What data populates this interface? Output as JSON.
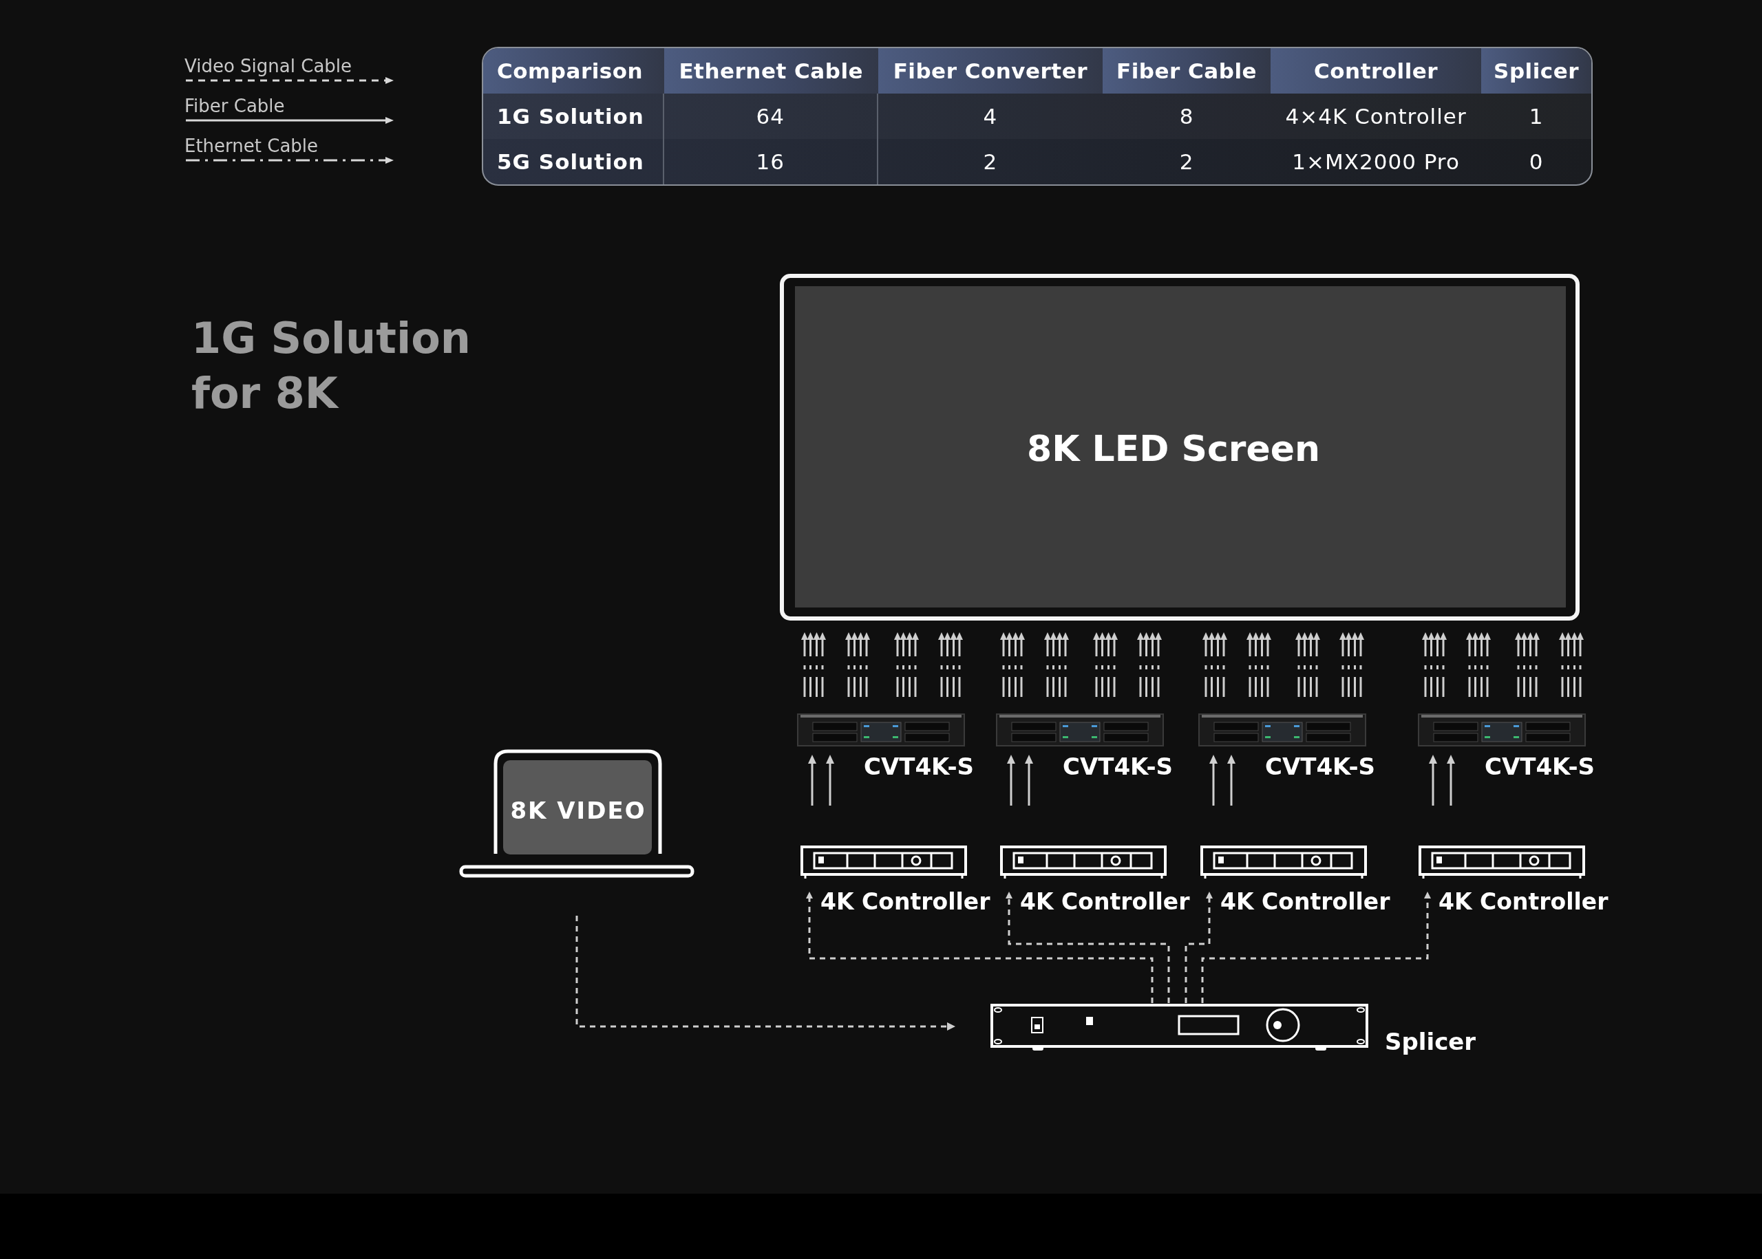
{
  "legend": [
    {
      "kind": "dashed",
      "label": "Video Signal Cable"
    },
    {
      "kind": "solid",
      "label": "Fiber Cable"
    },
    {
      "kind": "dashdot",
      "label": "Ethernet Cable"
    }
  ],
  "table": {
    "columns": [
      "Comparison",
      "Ethernet Cable",
      "Fiber Converter",
      "Fiber Cable",
      "Controller",
      "Splicer"
    ],
    "rows": [
      [
        "1G Solution",
        "64",
        "4",
        "8",
        "4×4K Controller",
        "1"
      ],
      [
        "5G Solution",
        "16",
        "2",
        "2",
        "1×MX2000 Pro",
        "0"
      ]
    ]
  },
  "title": "1G Solution for 8K",
  "diagram": {
    "screen_label": "8K LED Screen",
    "converters": [
      "CVT4K-S",
      "CVT4K-S",
      "CVT4K-S",
      "CVT4K-S"
    ],
    "controllers": [
      "4K Controller",
      "4K Controller",
      "4K Controller",
      "4K Controller"
    ],
    "source_label": "8K VIDEO",
    "splicer_label": "Splicer"
  }
}
